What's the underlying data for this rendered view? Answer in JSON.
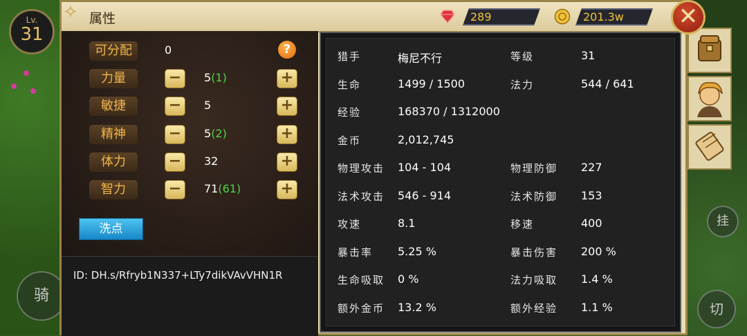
{
  "player": {
    "level_label": "Lv.",
    "level": "31"
  },
  "panel": {
    "title": "属性"
  },
  "currency": {
    "gems": "289",
    "gold": "201.3w"
  },
  "attributes": {
    "unassigned_label": "可分配",
    "unassigned_value": "0",
    "rows": [
      {
        "label": "力量",
        "base": "5",
        "bonus": "(1)"
      },
      {
        "label": "敏捷",
        "base": "5",
        "bonus": ""
      },
      {
        "label": "精神",
        "base": "5",
        "bonus": "(2)"
      },
      {
        "label": "体力",
        "base": "32",
        "bonus": ""
      },
      {
        "label": "智力",
        "base": "71",
        "bonus": "(61)"
      }
    ],
    "minus_glyph": "−",
    "plus_glyph": "+",
    "reset_label": "洗点",
    "help_glyph": "?"
  },
  "id_line": "ID:   DH.s/Rfryb1N337+LTy7dikVAvVHN1R",
  "stats": [
    {
      "label": "猎手",
      "value": "梅尼不行"
    },
    {
      "label": "等级",
      "value": "31"
    },
    {
      "label": "生命",
      "value": "1499 / 1500"
    },
    {
      "label": "法力",
      "value": "544 / 641"
    },
    {
      "label": "经验",
      "value": "168370 / 1312000"
    },
    {
      "label": "金币",
      "value": "2,012,745"
    },
    {
      "label": "物理攻击",
      "value": "104 - 104"
    },
    {
      "label": "物理防御",
      "value": "227"
    },
    {
      "label": "法术攻击",
      "value": "546 - 914"
    },
    {
      "label": "法术防御",
      "value": "153"
    },
    {
      "label": "攻速",
      "value": "8.1"
    },
    {
      "label": "移速",
      "value": "400"
    },
    {
      "label": "暴击率",
      "value": "5.25 %"
    },
    {
      "label": "暴击伤害",
      "value": "200 %"
    },
    {
      "label": "生命吸取",
      "value": "0 %"
    },
    {
      "label": "法力吸取",
      "value": "1.4 %"
    },
    {
      "label": "额外金币",
      "value": "13.2 %"
    },
    {
      "label": "额外经验",
      "value": "1.1 %"
    }
  ],
  "controls": {
    "ride": "骑",
    "hang": "挂",
    "switch": "切"
  },
  "icons": {
    "gem": "ruby-gem-icon",
    "gold": "gold-coin-icon",
    "close": "close-crossed-swords-icon",
    "bag": "bag-icon",
    "hero": "hero-portrait-icon",
    "scroll": "scroll-icon"
  },
  "colors": {
    "panel": "#e9dcb4",
    "accent_gold": "#f2c53a",
    "bonus_green": "#4fd44a",
    "reset_blue": "#1787c9"
  }
}
